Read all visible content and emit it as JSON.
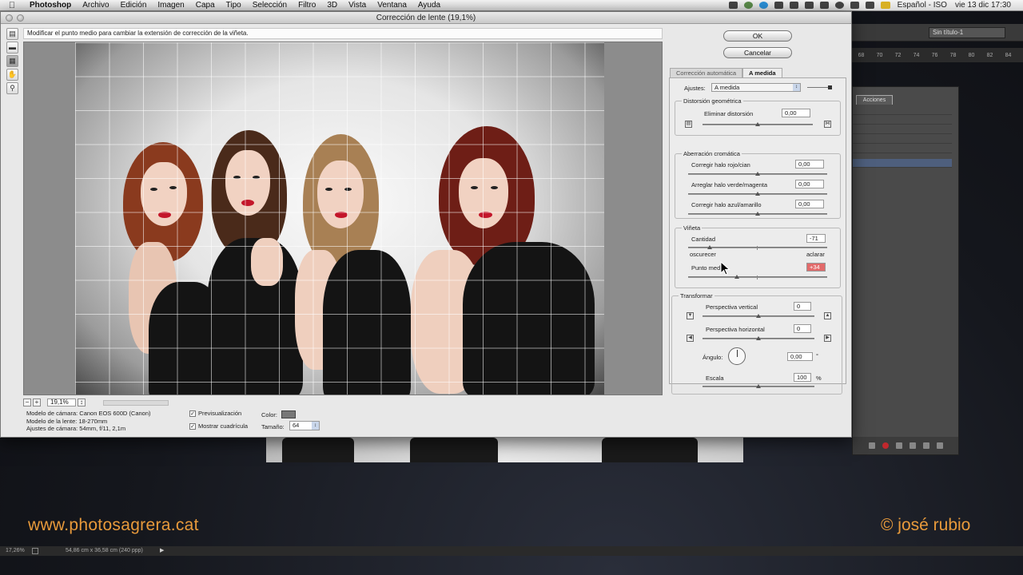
{
  "menubar": {
    "app": "Photoshop",
    "items": [
      "Archivo",
      "Edición",
      "Imagen",
      "Capa",
      "Tipo",
      "Selección",
      "Filtro",
      "3D",
      "Vista",
      "Ventana",
      "Ayuda"
    ],
    "language": "Español - ISO",
    "clock": "vie 13 dic  17:30"
  },
  "background": {
    "doc_select": "Sin título-1",
    "ruler_ticks": [
      "68",
      "70",
      "72",
      "74",
      "76",
      "78",
      "80",
      "82",
      "84"
    ],
    "panel_tab": "Acciones",
    "status_zoom": "17,26%",
    "status_dims": "54,86 cm x 36,58 cm (240 ppp)"
  },
  "watermark": {
    "site": "www.photosagrera.cat",
    "credit": "© josé rubio"
  },
  "dialog": {
    "title": "Corrección de lente (19,1%)",
    "hint": "Modificar el punto medio para cambiar la extensión de corrección de la viñeta.",
    "zoom": "19,1%",
    "zoom_minus": "−",
    "zoom_plus": "+",
    "camera_model": "Modelo de cámara: Canon EOS 600D (Canon)",
    "lens_model": "Modelo de la lente: 18-270mm",
    "camera_settings": "Ajustes de cámara: 54mm, f/11, 2,1m",
    "preview_label": "Previsualización",
    "show_grid_label": "Mostrar cuadrícula",
    "color_label": "Color:",
    "grid_color": "#777777",
    "size_label": "Tamaño:",
    "size_value": "64",
    "ok": "OK",
    "cancel": "Cancelar",
    "tabs": [
      "Corrección automática",
      "A medida"
    ],
    "settings_label": "Ajustes:",
    "settings_value": "A medida",
    "geo_title": "Distorsión geométrica",
    "remove_distortion_label": "Eliminar distorsión",
    "remove_distortion_value": "0,00",
    "chrom_title": "Aberración cromática",
    "red_cyan_label": "Corregir halo rojo/cian",
    "red_cyan_value": "0,00",
    "green_magenta_label": "Arreglar halo verde/magenta",
    "green_magenta_value": "0,00",
    "blue_yellow_label": "Corregir halo azul/amarillo",
    "blue_yellow_value": "0,00",
    "vignette_title": "Viñeta",
    "amount_label": "Cantidad",
    "amount_value": "-71",
    "darken_label": "oscurecer",
    "lighten_label": "aclarar",
    "midpoint_label": "Punto medio",
    "midpoint_value": "+34",
    "transform_title": "Transformar",
    "vertical_label": "Perspectiva vertical",
    "vertical_value": "0",
    "horizontal_label": "Perspectiva horizontal",
    "horizontal_value": "0",
    "angle_label": "Ángulo:",
    "angle_value": "0,00",
    "angle_unit": "°",
    "scale_label": "Escala",
    "scale_value": "100",
    "scale_unit": "%"
  }
}
